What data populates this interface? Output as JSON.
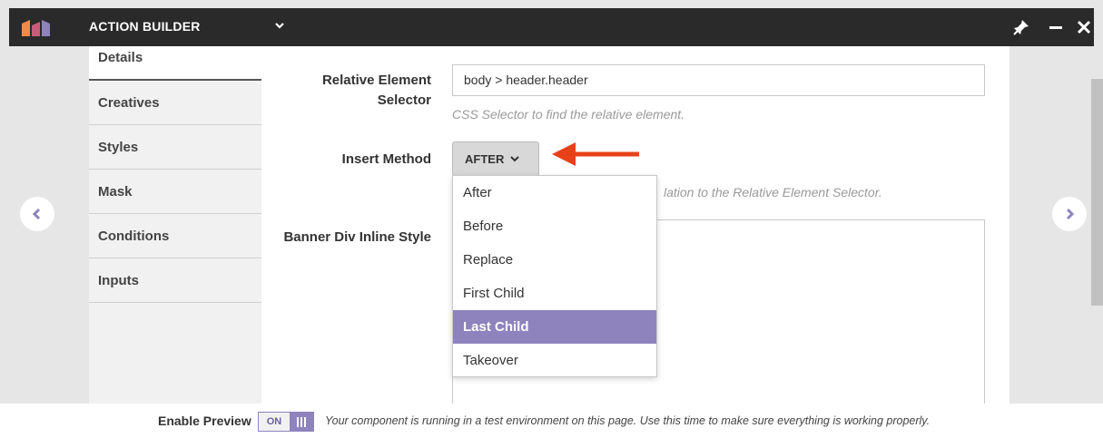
{
  "app": {
    "title": "ACTION BUILDER",
    "brand_color": "#8e83bd",
    "icons": [
      "marketo-logo-icon",
      "chevron-down-icon",
      "pin-icon",
      "minimize-icon",
      "close-icon"
    ]
  },
  "sidebar": {
    "items": [
      {
        "label": "Details",
        "active": true
      },
      {
        "label": "Creatives"
      },
      {
        "label": "Styles"
      },
      {
        "label": "Mask"
      },
      {
        "label": "Conditions"
      },
      {
        "label": "Inputs"
      }
    ]
  },
  "form": {
    "relative_selector": {
      "label_line1": "Relative Element",
      "label_line2": "Selector",
      "value": "body > header.header",
      "help": "CSS Selector to find the relative element."
    },
    "insert_method": {
      "label": "Insert Method",
      "selected_label": "AFTER",
      "help_visible_fragment": "lation to the Relative Element Selector.",
      "options": [
        "After",
        "Before",
        "Replace",
        "First Child",
        "Last Child",
        "Takeover"
      ],
      "highlighted": "Last Child"
    },
    "banner_style": {
      "label": "Banner Div Inline Style",
      "value": ""
    }
  },
  "footer": {
    "preview_label": "Enable Preview",
    "toggle_label": "ON",
    "message": "Your component is running in a test environment on this page. Use this time to make sure everything is working properly."
  },
  "annotation": {
    "arrow_color": "#e8411a"
  }
}
